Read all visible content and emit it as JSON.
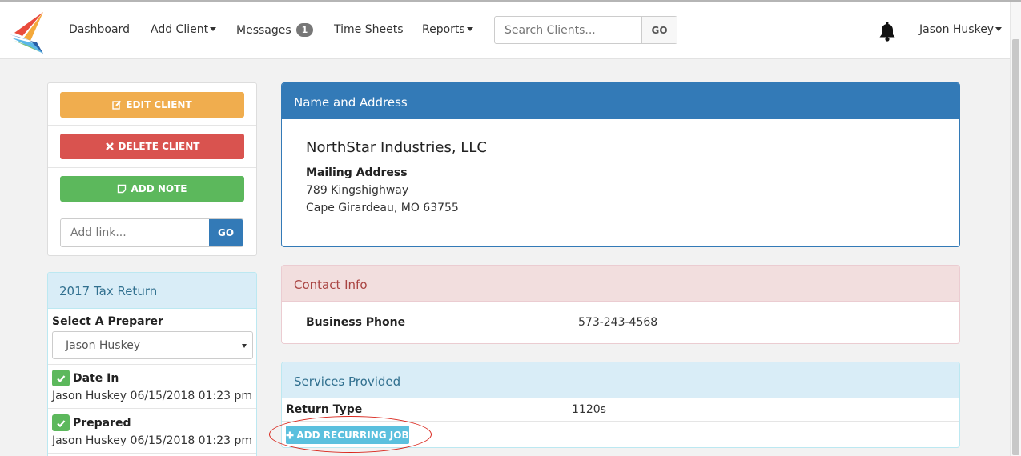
{
  "nav": {
    "dashboard": "Dashboard",
    "add_client": "Add Client",
    "messages": "Messages",
    "messages_count": "1",
    "time_sheets": "Time Sheets",
    "reports": "Reports",
    "search_placeholder": "Search Clients...",
    "search_go": "GO",
    "user": "Jason Huskey",
    "notifications_icon": "bell-icon"
  },
  "actions": {
    "edit_client": "EDIT CLIENT",
    "delete_client": "DELETE CLIENT",
    "add_note": "ADD NOTE",
    "link_placeholder": "Add link...",
    "link_go": "GO"
  },
  "tax_return": {
    "title": "2017 Tax Return",
    "preparer_label": "Select A Preparer",
    "preparer_selected": "Jason Huskey",
    "steps": [
      {
        "title": "Date In",
        "meta": "Jason Huskey 06/15/2018 01:23 pm"
      },
      {
        "title": "Prepared",
        "meta": "Jason Huskey 06/15/2018 01:23 pm"
      }
    ]
  },
  "name_address": {
    "title": "Name and Address",
    "client_name": "NorthStar Industries, LLC",
    "mailing_label": "Mailing Address",
    "address_line1": "789 Kingshighway",
    "address_line2": "Cape Girardeau, MO 63755"
  },
  "contact": {
    "title": "Contact Info",
    "business_phone_label": "Business Phone",
    "business_phone": "573-243-4568"
  },
  "services": {
    "title": "Services Provided",
    "return_type_label": "Return Type",
    "return_type": "1120s",
    "add_recurring_label": "ADD RECURRING JOB"
  },
  "colors": {
    "primary": "#337ab7",
    "warning": "#f0ad4e",
    "danger": "#d9534f",
    "success": "#5cb85c",
    "info": "#5bc0de",
    "annotation": "#d9261c"
  }
}
